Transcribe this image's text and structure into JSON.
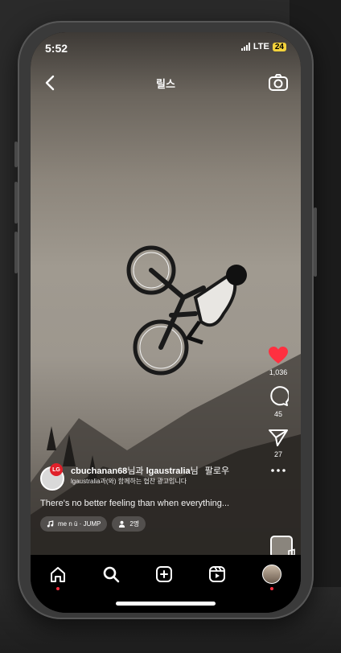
{
  "status": {
    "time": "5:52",
    "network": "LTE",
    "battery": "24"
  },
  "header": {
    "title": "릴스"
  },
  "actions": {
    "likes": "1,036",
    "comments": "45",
    "shares": "27"
  },
  "post": {
    "avatar_badge": "LG",
    "user1": "cbuchanan68",
    "joiner": "님과 ",
    "user2": "lgaustralia",
    "suffix": "님",
    "follow": "팔로우",
    "sponsor": "lgaustralia과(와) 함께하는 협찬 광고입니다",
    "caption": "There's no better feeling than when everything...",
    "music": "me n ü · JUMP",
    "people": "2명"
  },
  "colors": {
    "like": "#ff3040",
    "battery": "#f3d23b"
  },
  "nav": {
    "items": [
      "home-icon",
      "search-icon",
      "create-icon",
      "reels-icon",
      "profile-avatar"
    ]
  }
}
